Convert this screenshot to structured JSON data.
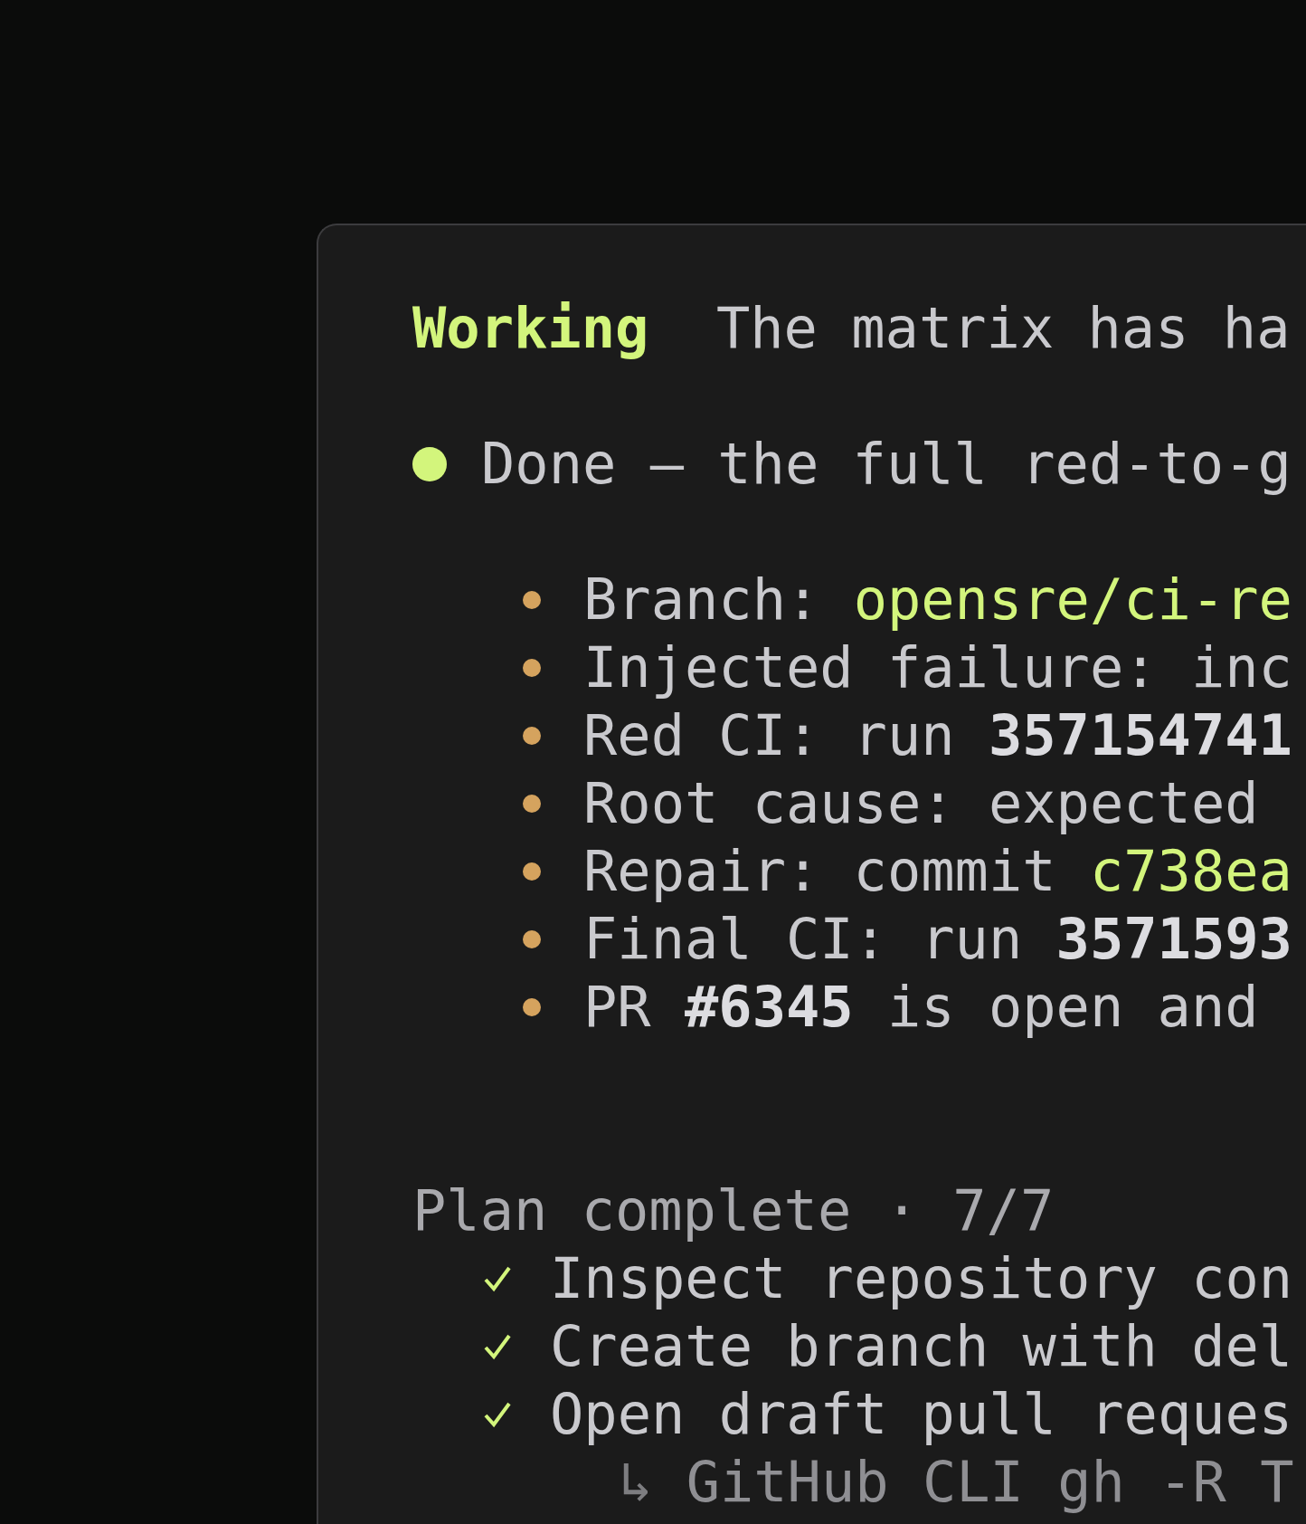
{
  "status": {
    "label": "Working",
    "message": "The matrix has ha"
  },
  "summary": {
    "text": "Done — the full red-to-g"
  },
  "details": [
    {
      "parts": [
        {
          "text": "Branch: ",
          "kind": "plain"
        },
        {
          "text": "opensre/ci-re",
          "kind": "accent"
        }
      ]
    },
    {
      "parts": [
        {
          "text": "Injected failure: inc",
          "kind": "plain"
        }
      ]
    },
    {
      "parts": [
        {
          "text": "Red CI: run ",
          "kind": "plain"
        },
        {
          "text": "357154741",
          "kind": "bold"
        }
      ]
    },
    {
      "parts": [
        {
          "text": "Root cause: expected",
          "kind": "plain"
        }
      ]
    },
    {
      "parts": [
        {
          "text": "Repair: commit ",
          "kind": "plain"
        },
        {
          "text": "c738ea",
          "kind": "accent"
        }
      ]
    },
    {
      "parts": [
        {
          "text": "Final CI: run ",
          "kind": "plain"
        },
        {
          "text": "3571593",
          "kind": "bold"
        }
      ]
    },
    {
      "parts": [
        {
          "text": "PR ",
          "kind": "plain"
        },
        {
          "text": "#6345",
          "kind": "bold"
        },
        {
          "text": " is open and",
          "kind": "plain"
        }
      ]
    }
  ],
  "plan": {
    "title": "Plan complete · 7/7",
    "steps": [
      {
        "text": "Inspect repository con",
        "done": true
      },
      {
        "text": "Create branch with del",
        "done": true
      },
      {
        "text": "Open draft pull reques",
        "done": true,
        "sub": {
          "arrow": "↳",
          "text": "GitHub CLI gh -R T"
        }
      }
    ]
  }
}
